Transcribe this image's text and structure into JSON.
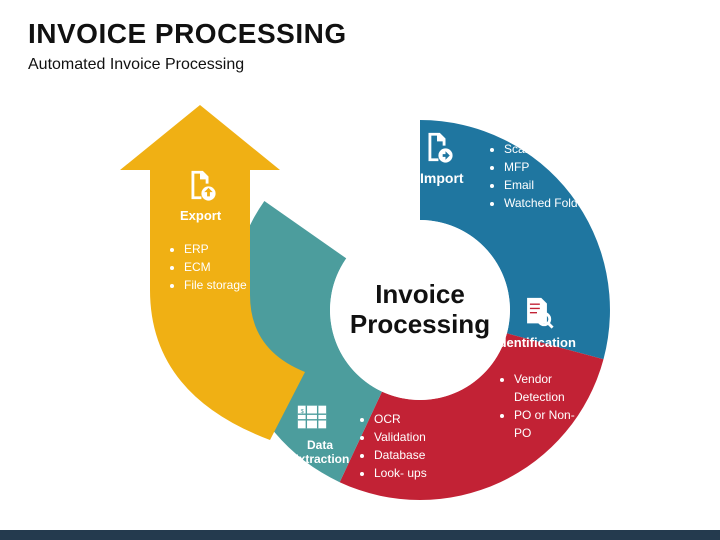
{
  "header": {
    "title": "INVOICE PROCESSING",
    "subtitle": "Automated Invoice Processing"
  },
  "center": {
    "line1": "Invoice",
    "line2": "Processing"
  },
  "segments": {
    "import": {
      "label": "Import",
      "items": [
        "Scanner",
        "MFP",
        "Email",
        "Watched Folder"
      ],
      "color": "#1f76a0"
    },
    "identification": {
      "label": "Identification",
      "items": [
        "Vendor Detection",
        "PO or Non-PO"
      ],
      "color": "#c22235"
    },
    "extraction": {
      "label": "Data Extraction",
      "items": [
        "OCR",
        "Validation",
        "Database",
        "Look- ups"
      ],
      "color": "#4c9d9d"
    },
    "export": {
      "label": "Export",
      "items": [
        "ERP",
        "ECM",
        "File storage"
      ],
      "color": "#f0b014"
    }
  }
}
